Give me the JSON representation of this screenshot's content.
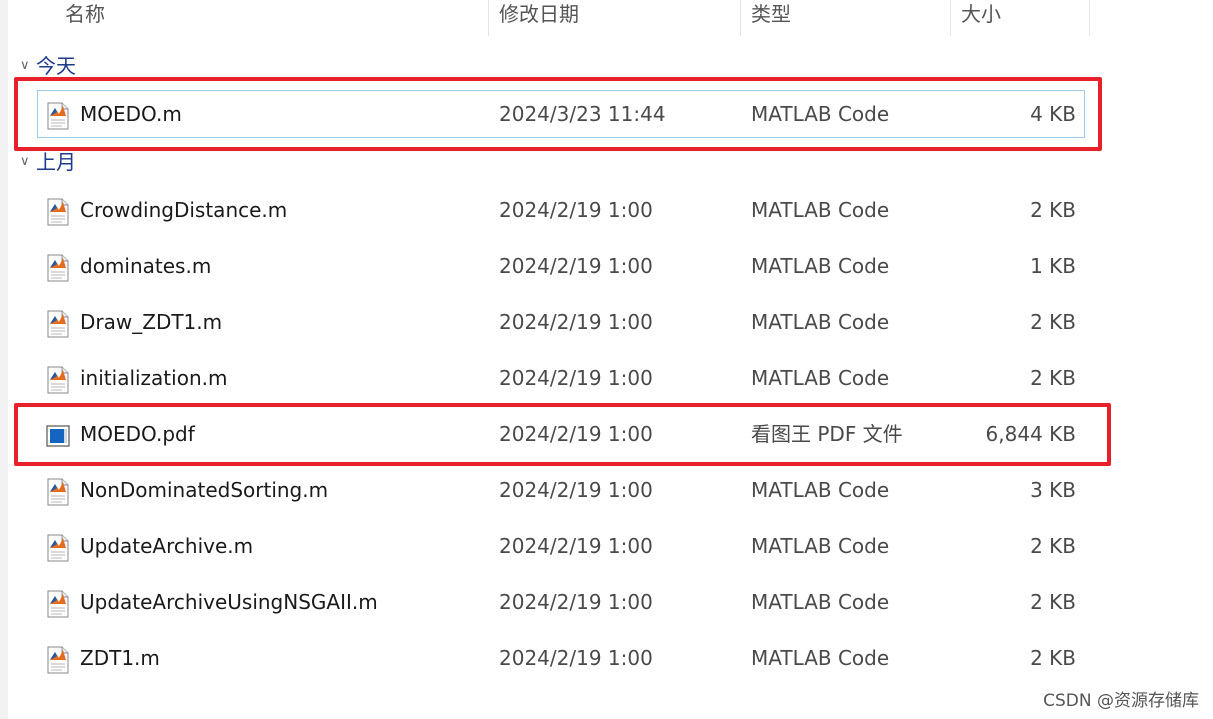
{
  "columns": {
    "name": "名称",
    "date": "修改日期",
    "type": "类型",
    "size": "大小"
  },
  "groups": [
    {
      "label": "今天",
      "files": [
        {
          "name": "MOEDO.m",
          "date": "2024/3/23 11:44",
          "type": "MATLAB Code",
          "size": "4 KB",
          "icon": "matlab-file-icon",
          "selected": true
        }
      ]
    },
    {
      "label": "上月",
      "files": [
        {
          "name": "CrowdingDistance.m",
          "date": "2024/2/19 1:00",
          "type": "MATLAB Code",
          "size": "2 KB",
          "icon": "matlab-file-icon"
        },
        {
          "name": "dominates.m",
          "date": "2024/2/19 1:00",
          "type": "MATLAB Code",
          "size": "1 KB",
          "icon": "matlab-file-icon"
        },
        {
          "name": "Draw_ZDT1.m",
          "date": "2024/2/19 1:00",
          "type": "MATLAB Code",
          "size": "2 KB",
          "icon": "matlab-file-icon"
        },
        {
          "name": "initialization.m",
          "date": "2024/2/19 1:00",
          "type": "MATLAB Code",
          "size": "2 KB",
          "icon": "matlab-file-icon"
        },
        {
          "name": "MOEDO.pdf",
          "date": "2024/2/19 1:00",
          "type": "看图王 PDF 文件",
          "size": "6,844 KB",
          "icon": "pdf-file-icon"
        },
        {
          "name": "NonDominatedSorting.m",
          "date": "2024/2/19 1:00",
          "type": "MATLAB Code",
          "size": "3 KB",
          "icon": "matlab-file-icon"
        },
        {
          "name": "UpdateArchive.m",
          "date": "2024/2/19 1:00",
          "type": "MATLAB Code",
          "size": "2 KB",
          "icon": "matlab-file-icon"
        },
        {
          "name": "UpdateArchiveUsingNSGAII.m",
          "date": "2024/2/19 1:00",
          "type": "MATLAB Code",
          "size": "2 KB",
          "icon": "matlab-file-icon"
        },
        {
          "name": "ZDT1.m",
          "date": "2024/2/19 1:00",
          "type": "MATLAB Code",
          "size": "2 KB",
          "icon": "matlab-file-icon"
        }
      ]
    }
  ],
  "watermark": "CSDN @资源存储库",
  "colors": {
    "highlight": "#e8202a",
    "group_label": "#1e3a8a",
    "selection_border": "#9ecbe8",
    "pdf_icon": "#1565c0",
    "matlab_icon": "#e36c1d"
  }
}
